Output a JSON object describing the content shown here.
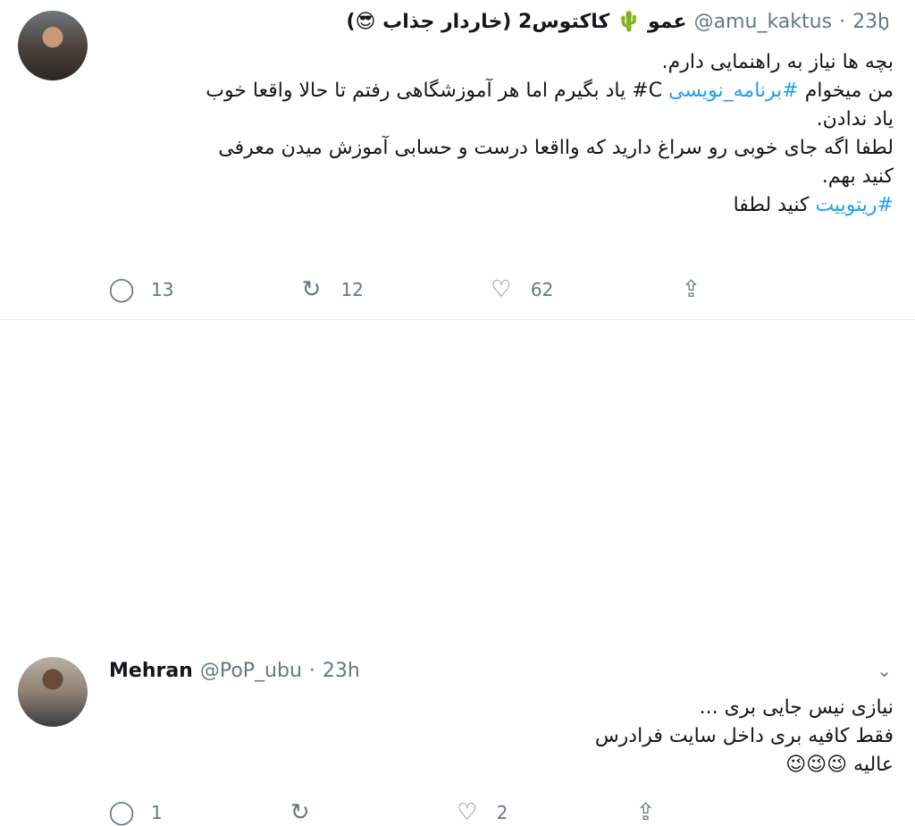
{
  "tweets": [
    {
      "display_name": "عمو 🌵 کاکتوس2 (خاردار جذاب 😎)",
      "handle": "@amu_kaktus",
      "time": "23h",
      "lines": [
        "بچه ها نیاز به راهنمایی دارم.",
        "من میخوام #برنامه_نویسی C# یاد بگیرم اما هر آموزشگاهی رفتم تا حالا واقعا خوب",
        "یاد ندادن.",
        "لطفا اگه جای خوبی رو سراغ دارید که وااقعا درست و حسابی آموزش میدن معرفی",
        "کنید بهم.",
        "",
        "#ریتوییت کنید لطفا"
      ],
      "hashtags": [
        "#برنامه_نویسی",
        "#ریتوییت"
      ],
      "actions": {
        "reply": "13",
        "retweet": "12",
        "like": "62"
      }
    },
    {
      "display_name": "Mehran",
      "handle": "@PoP_ubu",
      "time": "23h",
      "lines": [
        "نیازی نیس جایی بری ...",
        "فقط کافیه بری داخل سایت فرادرس",
        "عالیه 😉😉😉"
      ],
      "actions": {
        "reply": "1",
        "retweet": "",
        "like": "2"
      }
    }
  ],
  "icons": {
    "reply": "reply-icon",
    "retweet": "retweet-icon",
    "like": "heart-icon",
    "share": "share-icon",
    "more": "chevron-down-icon"
  },
  "colors": {
    "link": "#1da1f2",
    "secondary_text": "#657786",
    "thread_line": "#ccd6dd",
    "border": "#e6ecf0"
  }
}
